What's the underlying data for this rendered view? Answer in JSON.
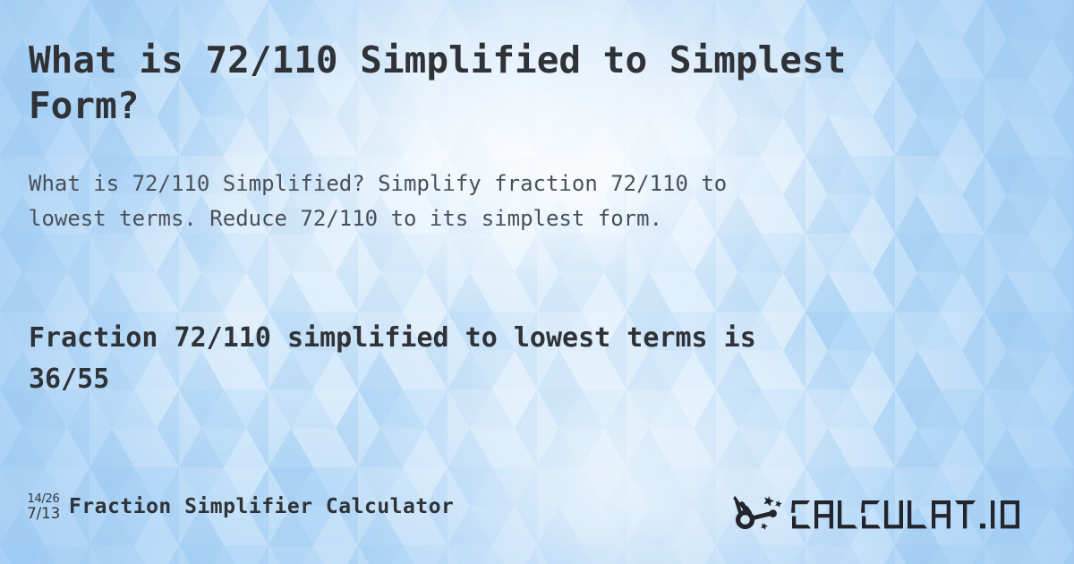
{
  "page": {
    "title_line1": "What is 72/110 Simplified to Simplest",
    "title_line2": "Form?",
    "title_full": "What is 72/110 Simplified to Simplest Form?",
    "subtitle_line1": "What is 72/110 Simplified? Simplify fraction 72/110 to",
    "subtitle_line2": "lowest terms. Reduce 72/110 to its simplest form.",
    "subtitle_full": "What is 72/110 Simplified? Simplify fraction 72/110 to lowest terms. Reduce 72/110 to its simplest form.",
    "result_line1": "Fraction 72/110 simplified to lowest terms is",
    "result_line2": "36/55",
    "result_full": "Fraction 72/110 simplified to lowest terms is 36/55"
  },
  "fraction": {
    "original": "72/110",
    "numerator": "72",
    "denominator": "110",
    "simplified": "36/55",
    "simplified_numerator": "36",
    "simplified_denominator": "55"
  },
  "footer": {
    "icon": {
      "name": "fraction-simplify-icon",
      "top": "14/26",
      "bottom": "7/13"
    },
    "tool_name": "Fraction Simplifier Calculator",
    "brand": {
      "name": "CALCULAT.IO",
      "mark": "magic-wand-hand-icon"
    }
  },
  "colors": {
    "background_blue": "#b9daf6",
    "background_highlight": "#ffffff",
    "title_text": "#2f3237",
    "subtitle_text": "#4a5059",
    "result_text": "#2f3237",
    "logo_dark": "#22262c"
  }
}
